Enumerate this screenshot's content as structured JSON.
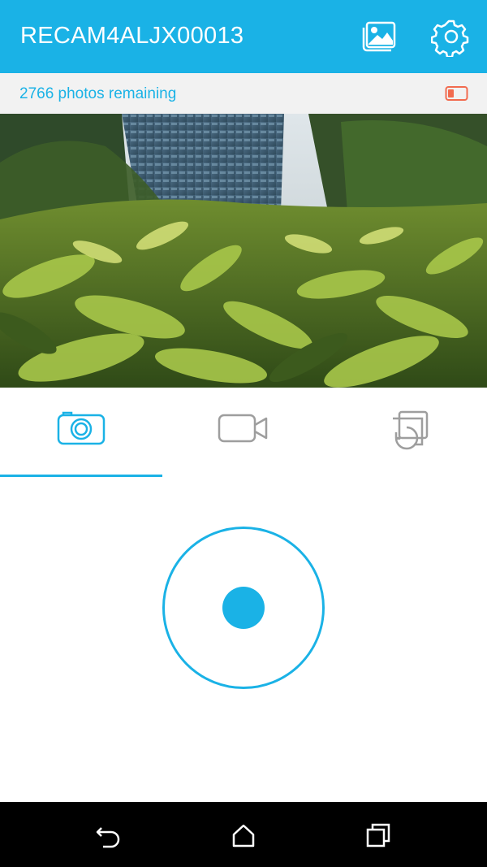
{
  "header": {
    "title": "RECAM4ALJX00013",
    "gallery_icon": "gallery-icon",
    "settings_icon": "gear-icon"
  },
  "status": {
    "remaining_text": "2766 photos remaining",
    "battery_icon": "battery-low-icon",
    "battery_color": "#f26b4f"
  },
  "preview": {
    "description_icon": "camera-live-preview"
  },
  "modes": [
    {
      "name": "photo",
      "icon": "camera-icon",
      "selected": true
    },
    {
      "name": "video",
      "icon": "video-camera-icon",
      "selected": false
    },
    {
      "name": "timelapse",
      "icon": "timelapse-icon",
      "selected": false
    }
  ],
  "shutter": {
    "icon": "shutter-button"
  },
  "colors": {
    "accent": "#1ab2e6",
    "inactive_icon": "#9e9e9e",
    "status_bg": "#f2f2f2"
  },
  "system_nav": {
    "back_icon": "back-icon",
    "home_icon": "home-icon",
    "recents_icon": "recents-icon"
  }
}
